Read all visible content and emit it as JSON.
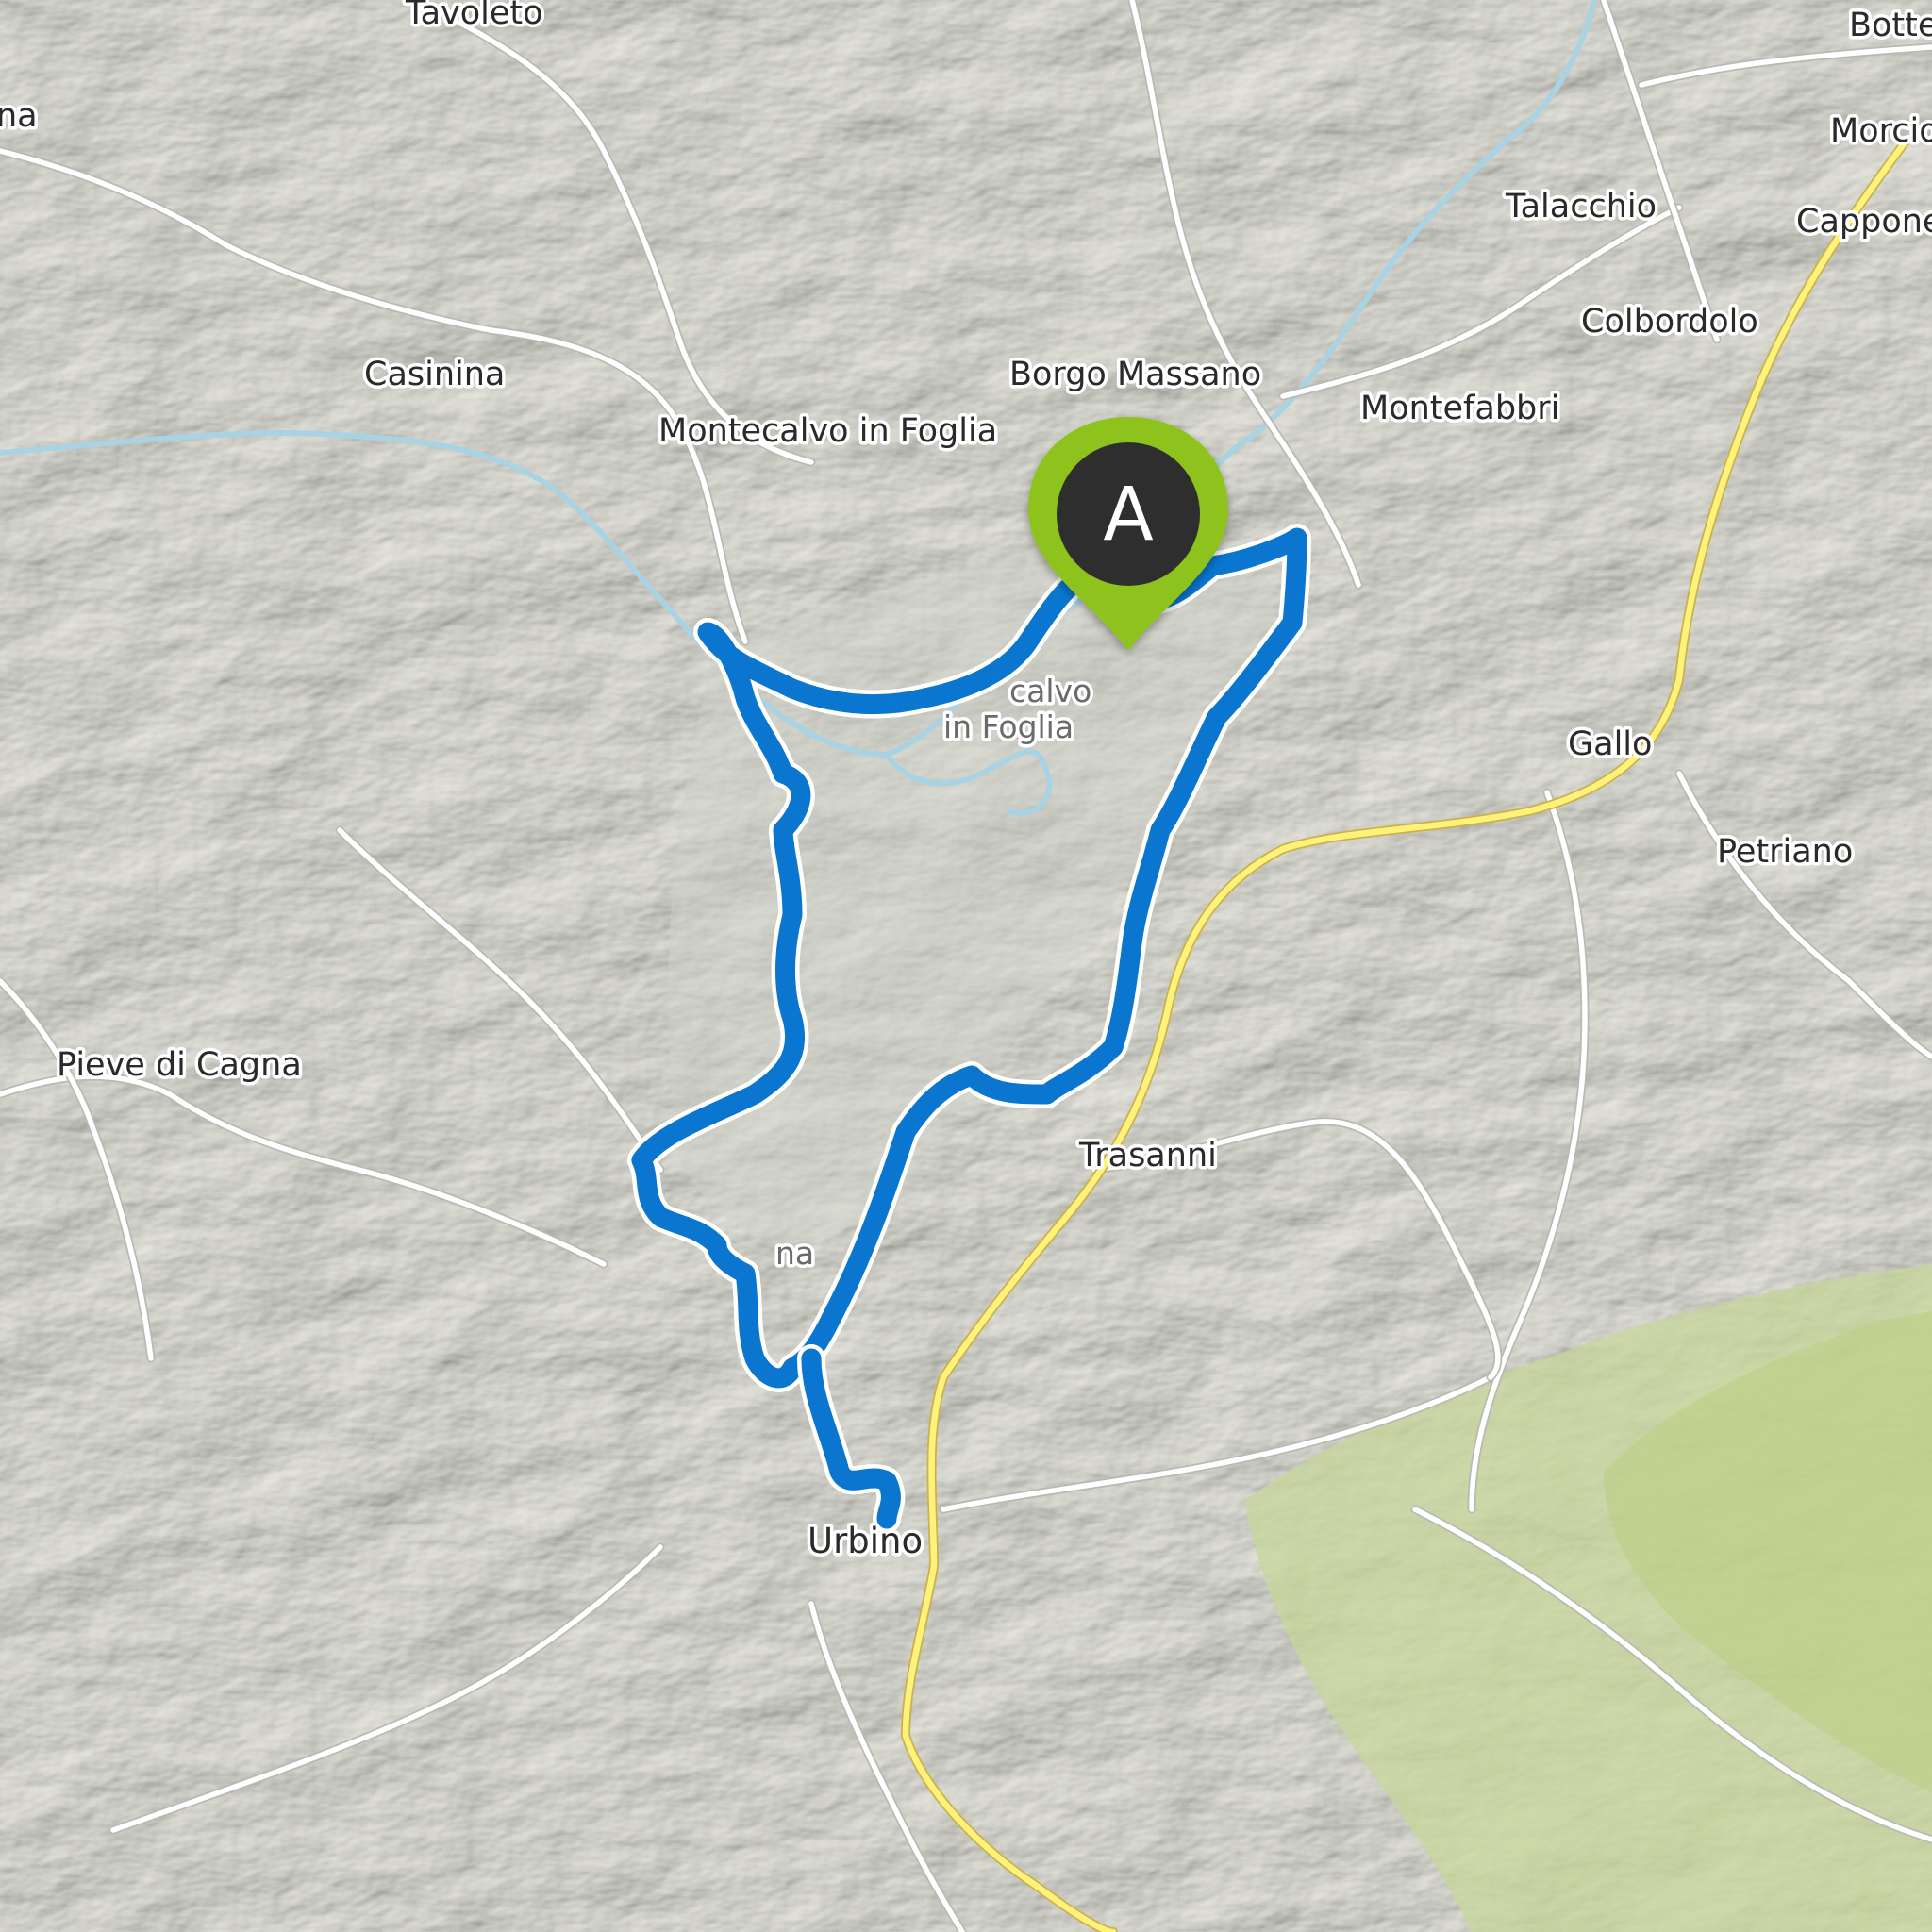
{
  "map": {
    "route_color": "#0a76d0",
    "marker": {
      "label": "A",
      "pin_color": "#8ec21a",
      "head_color": "#2f2f2f",
      "text_color": "#ffffff"
    },
    "place_labels": [
      {
        "id": "tavoleto",
        "name": "Tavoleto"
      },
      {
        "id": "bottega",
        "name": "Botte"
      },
      {
        "id": "morciola",
        "name": "Morcio"
      },
      {
        "id": "talacchio",
        "name": "Talacchio"
      },
      {
        "id": "cappone",
        "name": "Cappone"
      },
      {
        "id": "colbordolo",
        "name": "Colbordolo"
      },
      {
        "id": "casinina",
        "name": "Casinina"
      },
      {
        "id": "borgo-massano",
        "name": "Borgo Massano"
      },
      {
        "id": "montefabbri",
        "name": "Montefabbri"
      },
      {
        "id": "montecalvo-in-foglia",
        "name": "Montecalvo in Foglia"
      },
      {
        "id": "gallo",
        "name": "Gallo"
      },
      {
        "id": "petriano",
        "name": "Petriano"
      },
      {
        "id": "pieve-di-cagna",
        "name": "Pieve di Cagna"
      },
      {
        "id": "trasanni",
        "name": "Trasanni"
      },
      {
        "id": "urbino",
        "name": "Urbino"
      },
      {
        "id": "edge-left-na",
        "name": "na"
      }
    ],
    "ghost_labels": [
      {
        "id": "montecalvo-area-1",
        "name": "calvo"
      },
      {
        "id": "montecalvo-area-2",
        "name": "in Foglia"
      },
      {
        "id": "hidden-town",
        "name": "na"
      }
    ]
  }
}
